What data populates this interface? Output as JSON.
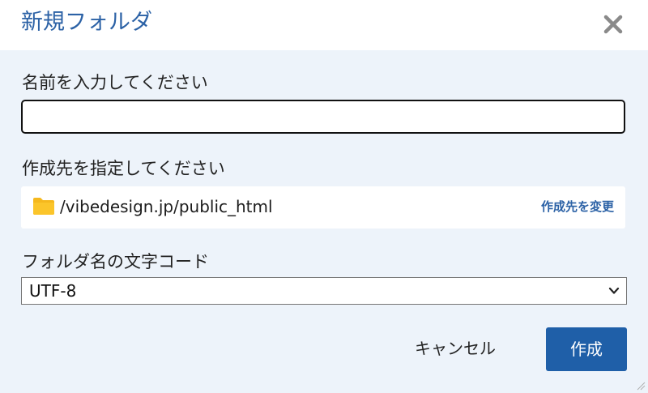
{
  "dialog": {
    "title": "新規フォルダ",
    "close_icon": "close-icon"
  },
  "name_field": {
    "label": "名前を入力してください",
    "value": "",
    "placeholder": ""
  },
  "destination": {
    "label": "作成先を指定してください",
    "icon": "folder-icon",
    "path": "/vibedesign.jp/public_html",
    "change_link": "作成先を変更"
  },
  "encoding": {
    "label": "フォルダ名の文字コード",
    "selected": "UTF-8",
    "icon": "chevron-down-icon"
  },
  "actions": {
    "cancel_label": "キャンセル",
    "create_label": "作成"
  },
  "colors": {
    "accent": "#1f5fa8",
    "title": "#2c62a6",
    "background": "#edf3fa",
    "folder": "#f5b81d"
  }
}
